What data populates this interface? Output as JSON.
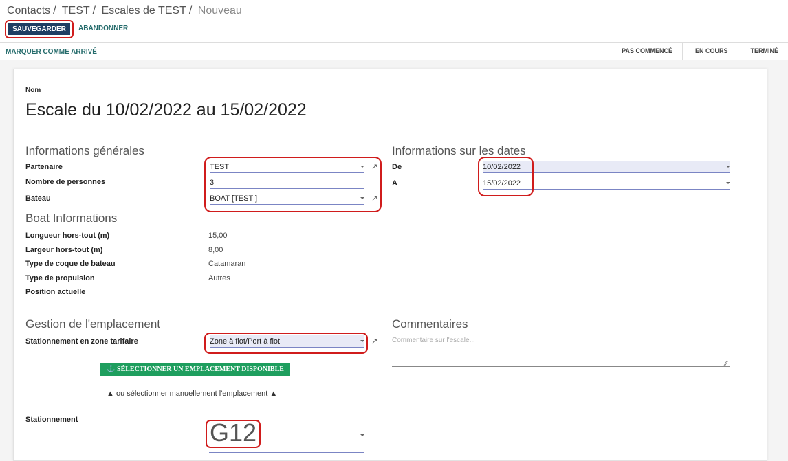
{
  "breadcrumb": [
    "Contacts",
    "TEST",
    "Escales de TEST",
    "Nouveau"
  ],
  "actions": {
    "save": "SAUVEGARDER",
    "discard": "ABANDONNER"
  },
  "statusbar": {
    "mark_arrived": "MARQUER COMME ARRIVÉ",
    "stages": [
      "PAS COMMENCÉ",
      "EN COURS",
      "TERMINÉ"
    ]
  },
  "form": {
    "name_label": "Nom",
    "name_value": "Escale du 10/02/2022 au 15/02/2022",
    "general": {
      "heading": "Informations générales",
      "partner_label": "Partenaire",
      "partner_value": "TEST",
      "persons_label": "Nombre de personnes",
      "persons_value": "3",
      "boat_label": "Bateau",
      "boat_value": "BOAT [TEST ]"
    },
    "dates": {
      "heading": "Informations sur les dates",
      "from_label": "De",
      "from_value": "10/02/2022",
      "to_label": "A",
      "to_value": "15/02/2022"
    },
    "boat_info": {
      "heading": "Boat Informations",
      "rows": [
        {
          "label": "Longueur hors-tout (m)",
          "value": "15,00"
        },
        {
          "label": "Largeur hors-tout (m)",
          "value": "8,00"
        },
        {
          "label": "Type de coque de bateau",
          "value": "Catamaran"
        },
        {
          "label": "Type de propulsion",
          "value": "Autres"
        },
        {
          "label": "Position actuelle",
          "value": ""
        }
      ]
    },
    "location": {
      "heading": "Gestion de l'emplacement",
      "zone_label": "Stationnement en zone tarifaire",
      "zone_value": "Zone à flot/Port à flot",
      "select_button": "SÉLECTIONNER UN EMPLACEMENT DISPONIBLE",
      "manual_text": "ou sélectionner manuellement l'emplacement",
      "parking_label": "Stationnement",
      "parking_value": "G12"
    },
    "comments": {
      "heading": "Commentaires",
      "placeholder": "Commentaire sur l'escale..."
    }
  },
  "colors": {
    "primary": "#1f3e63",
    "accent": "#246b6b",
    "green": "#1e9e5e",
    "highlight": "#d01c1c"
  }
}
